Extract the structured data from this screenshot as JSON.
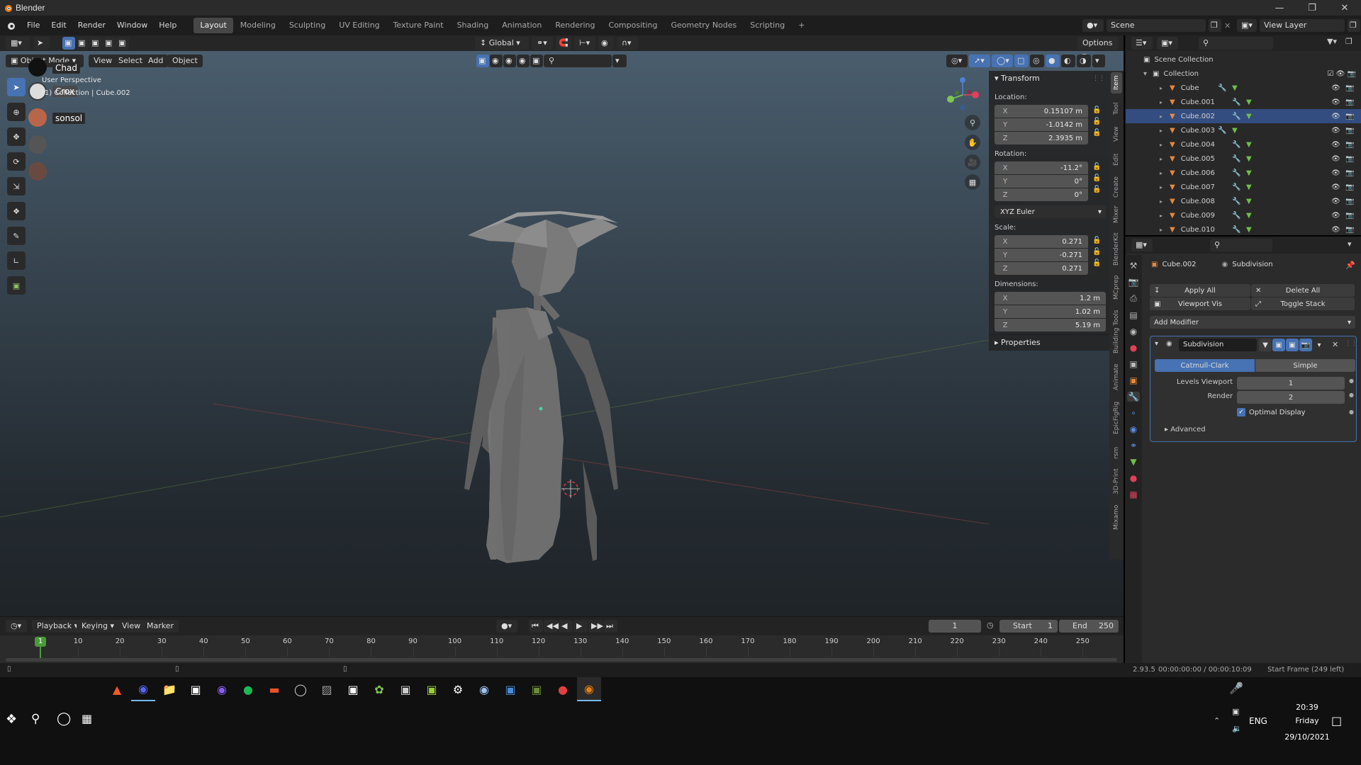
{
  "window": {
    "title": "Blender"
  },
  "menu": [
    "File",
    "Edit",
    "Render",
    "Window",
    "Help"
  ],
  "workspaces": [
    "Layout",
    "Modeling",
    "Sculpting",
    "UV Editing",
    "Texture Paint",
    "Shading",
    "Animation",
    "Rendering",
    "Compositing",
    "Geometry Nodes",
    "Scripting"
  ],
  "active_workspace": "Layout",
  "scene": {
    "label": "Scene",
    "view_layer": "View Layer"
  },
  "toolheader": {
    "transform_orientation": "Global",
    "options": "Options"
  },
  "viewport": {
    "mode": "Object Mode",
    "menus": [
      "View",
      "Select",
      "Add",
      "Object"
    ],
    "view_name": "User Perspective",
    "collection_path": "(1) Collection | Cube.002",
    "presence": [
      {
        "name": "Chad"
      },
      {
        "name": "Crox"
      },
      {
        "name": "sonsol"
      }
    ]
  },
  "npanel": {
    "transform_title": "Transform",
    "location_label": "Location:",
    "location": {
      "x": "0.15107 m",
      "y": "-1.0142 m",
      "z": "2.3935 m"
    },
    "rotation_label": "Rotation:",
    "rotation": {
      "x": "-11.2°",
      "y": "0°",
      "z": "0°"
    },
    "rotation_mode": "XYZ Euler",
    "scale_label": "Scale:",
    "scale": {
      "x": "0.271",
      "y": "-0.271",
      "z": "0.271"
    },
    "dimensions_label": "Dimensions:",
    "dimensions": {
      "x": "1.2 m",
      "y": "1.02 m",
      "z": "5.19 m"
    },
    "properties_title": "Properties",
    "axis": {
      "x": "X",
      "y": "Y",
      "z": "Z"
    },
    "tabs": [
      "Item",
      "Tool",
      "View",
      "Edit",
      "Create",
      "Mixer",
      "BlenderKit",
      "MCprep",
      "Building Tools",
      "Animate",
      "EpicFigRig",
      "rsm",
      "3D-Print",
      "Mixamo"
    ]
  },
  "outliner": {
    "scene_collection": "Scene Collection",
    "collection": "Collection",
    "objects": [
      "Cube",
      "Cube.001",
      "Cube.002",
      "Cube.003",
      "Cube.004",
      "Cube.005",
      "Cube.006",
      "Cube.007",
      "Cube.008",
      "Cube.009",
      "Cube.010"
    ],
    "selected": "Cube.002"
  },
  "properties": {
    "object_name": "Cube.002",
    "modifier_context": "Subdivision",
    "apply_all": "Apply All",
    "delete_all": "Delete All",
    "viewport_vis": "Viewport Vis",
    "toggle_stack": "Toggle Stack",
    "add_modifier": "Add Modifier",
    "modifier": {
      "name": "Subdivision",
      "type_catmull": "Catmull-Clark",
      "type_simple": "Simple",
      "levels_viewport_label": "Levels Viewport",
      "levels_viewport": "1",
      "render_label": "Render",
      "render": "2",
      "optimal_display": "Optimal Display",
      "advanced": "Advanced"
    }
  },
  "timeline": {
    "menus": [
      "Playback",
      "Keying",
      "View",
      "Marker"
    ],
    "current_frame": "1",
    "start_label": "Start",
    "start": "1",
    "end_label": "End",
    "end": "250",
    "ticks": [
      "1",
      "10",
      "20",
      "30",
      "40",
      "50",
      "60",
      "70",
      "80",
      "90",
      "100",
      "110",
      "120",
      "130",
      "140",
      "150",
      "160",
      "170",
      "180",
      "190",
      "200",
      "210",
      "220",
      "230",
      "240",
      "250"
    ]
  },
  "statusbar": {
    "version": "2.93.5",
    "time": "00:00:00:00 / 00:00:10:09",
    "info": "Start Frame (249 left)"
  },
  "taskbar": {
    "time": "20:39",
    "day": "Friday",
    "date": "29/10/2021",
    "lang": "ENG"
  },
  "colors": {
    "accent": "#4772b3",
    "object_orange": "#e8883a",
    "mesh_green": "#6fbf4a"
  }
}
